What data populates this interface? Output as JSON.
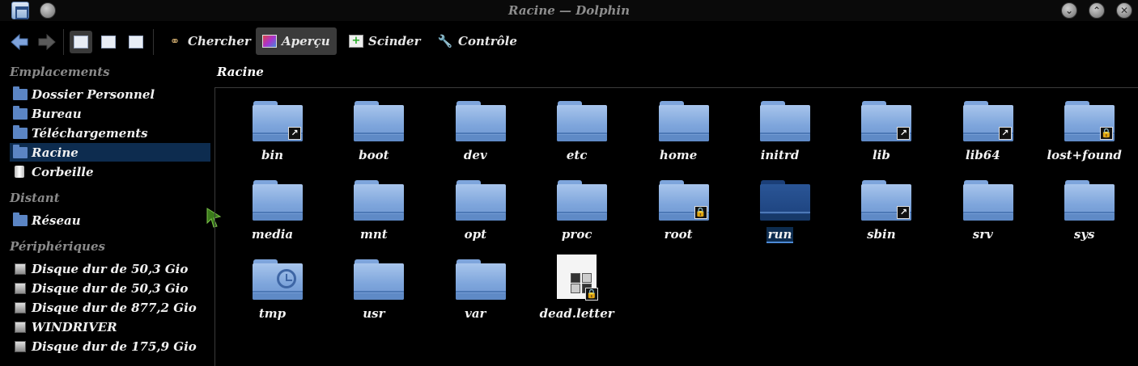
{
  "window": {
    "title": "Racine — Dolphin",
    "buttons": [
      "minimize-button",
      "maximize-button",
      "close-button"
    ]
  },
  "toolbar": {
    "back_icon": "back-arrow-icon",
    "forward_icon": "forward-arrow-icon",
    "view_modes": [
      "icons-view",
      "details-view",
      "columns-view"
    ],
    "search_label": "Chercher",
    "preview_label": "Aperçu",
    "split_label": "Scinder",
    "terminal_label": "Contrôle"
  },
  "sidebar": {
    "places_title": "Emplacements",
    "places": [
      {
        "label": "Dossier Personnel",
        "icon": "folder-home-icon"
      },
      {
        "label": "Bureau",
        "icon": "desktop-icon"
      },
      {
        "label": "Téléchargements",
        "icon": "downloads-folder-icon"
      },
      {
        "label": "Racine",
        "icon": "folder-icon",
        "selected": true
      },
      {
        "label": "Corbeille",
        "icon": "trash-icon"
      }
    ],
    "remote_title": "Distant",
    "remote": [
      {
        "label": "Réseau",
        "icon": "network-folder-icon"
      }
    ],
    "devices_title": "Périphériques",
    "devices": [
      {
        "label": "Disque dur de 50,3 Gio",
        "icon": "hard-disk-icon"
      },
      {
        "label": "Disque dur de 50,3 Gio",
        "icon": "hard-disk-icon"
      },
      {
        "label": "Disque dur de 877,2 Gio",
        "icon": "hard-disk-icon"
      },
      {
        "label": "WINDRIVER",
        "icon": "hard-disk-icon"
      },
      {
        "label": "Disque dur de 175,9 Gio",
        "icon": "hard-disk-icon"
      }
    ]
  },
  "main": {
    "location": "Racine",
    "items": [
      {
        "name": "bin",
        "emblem": "link"
      },
      {
        "name": "boot",
        "emblem": ""
      },
      {
        "name": "dev",
        "emblem": ""
      },
      {
        "name": "etc",
        "emblem": ""
      },
      {
        "name": "home",
        "emblem": ""
      },
      {
        "name": "initrd",
        "emblem": ""
      },
      {
        "name": "lib",
        "emblem": "link"
      },
      {
        "name": "lib64",
        "emblem": "link"
      },
      {
        "name": "lost+found",
        "emblem": "lock"
      },
      {
        "name": "media",
        "emblem": ""
      },
      {
        "name": "mnt",
        "emblem": ""
      },
      {
        "name": "opt",
        "emblem": ""
      },
      {
        "name": "proc",
        "emblem": ""
      },
      {
        "name": "root",
        "emblem": "lock"
      },
      {
        "name": "run",
        "emblem": "",
        "selected": true
      },
      {
        "name": "sbin",
        "emblem": "link"
      },
      {
        "name": "srv",
        "emblem": ""
      },
      {
        "name": "sys",
        "emblem": ""
      },
      {
        "name": "tmp",
        "emblem": "clock"
      },
      {
        "name": "usr",
        "emblem": ""
      },
      {
        "name": "var",
        "emblem": ""
      },
      {
        "name": "dead.letter",
        "emblem": "lock",
        "type": "file"
      }
    ]
  },
  "colors": {
    "background": "#000000",
    "selection": "#0d2c4f",
    "folder": "#7fa6dc",
    "section_title": "#8a8a8a"
  }
}
